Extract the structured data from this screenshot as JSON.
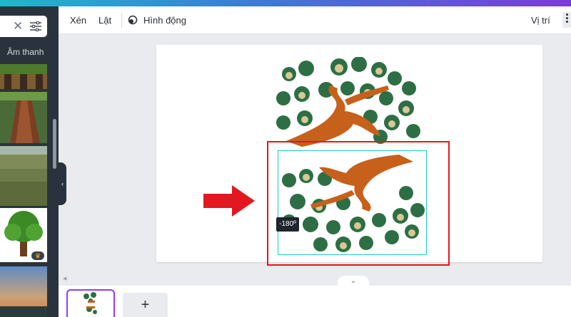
{
  "left_panel": {
    "search_clear_icon": "close-icon",
    "filter_icon": "sliders-icon",
    "category_label": "Âm thanh",
    "premium_icon": "crown-icon",
    "collapse_icon": "chevron-left-icon"
  },
  "toolbar": {
    "crop_label": "Xén",
    "flip_label": "Lật",
    "animate_label": "Hình động",
    "animate_icon": "animation-icon",
    "position_label": "Vị trí",
    "more_icon": "more-vertical-icon"
  },
  "canvas": {
    "rotation_badge": "-180º"
  },
  "bottom": {
    "add_page_label": "+",
    "page_toggle_icon": "chevron-down-icon"
  },
  "colors": {
    "annotation_red": "#e3171f",
    "selection_cyan": "#1ec9d1",
    "panel_dark": "#2a333d",
    "accent_purple": "#8b3dff"
  }
}
